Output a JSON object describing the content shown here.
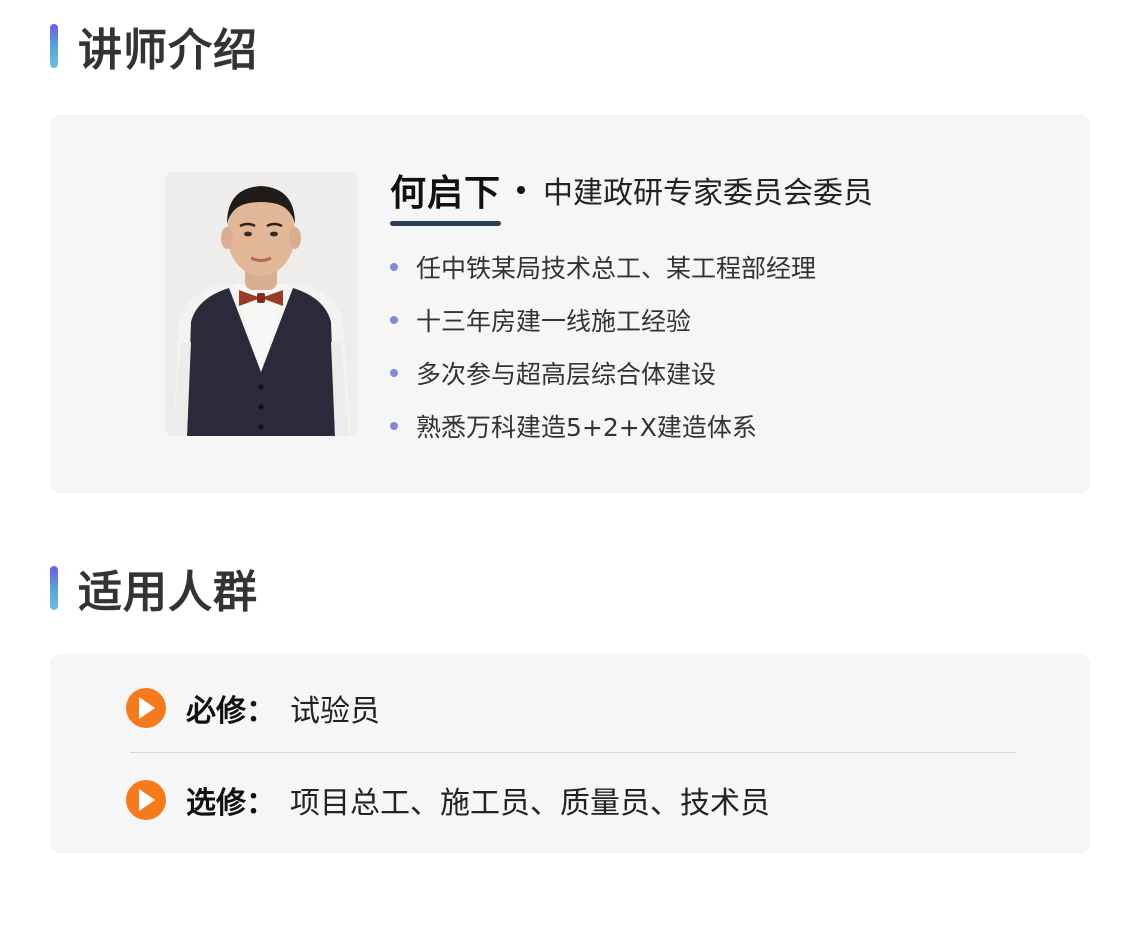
{
  "sections": {
    "lecturer": {
      "title": "讲师介绍"
    },
    "audience": {
      "title": "适用人群"
    }
  },
  "lecturer": {
    "name": "何启下",
    "title": "中建政研专家委员会委员",
    "bullets": [
      "任中铁某局技术总工、某工程部经理",
      "十三年房建一线施工经验",
      "多次参与超高层综合体建设",
      "熟悉万科建造5+2+X建造体系"
    ]
  },
  "audience": {
    "required": {
      "label": "必修：",
      "value": "试验员"
    },
    "elective": {
      "label": "选修：",
      "value": "项目总工、施工员、质量员、技术员"
    }
  },
  "colors": {
    "accent_gradient_top": "#6b5be6",
    "accent_gradient_bottom": "#6cc0d8",
    "play_icon": "#f57a1b",
    "bullet_dot": "#7f8ccf",
    "name_underline": "#2c3e55",
    "card_background": "#f6f6f6"
  }
}
